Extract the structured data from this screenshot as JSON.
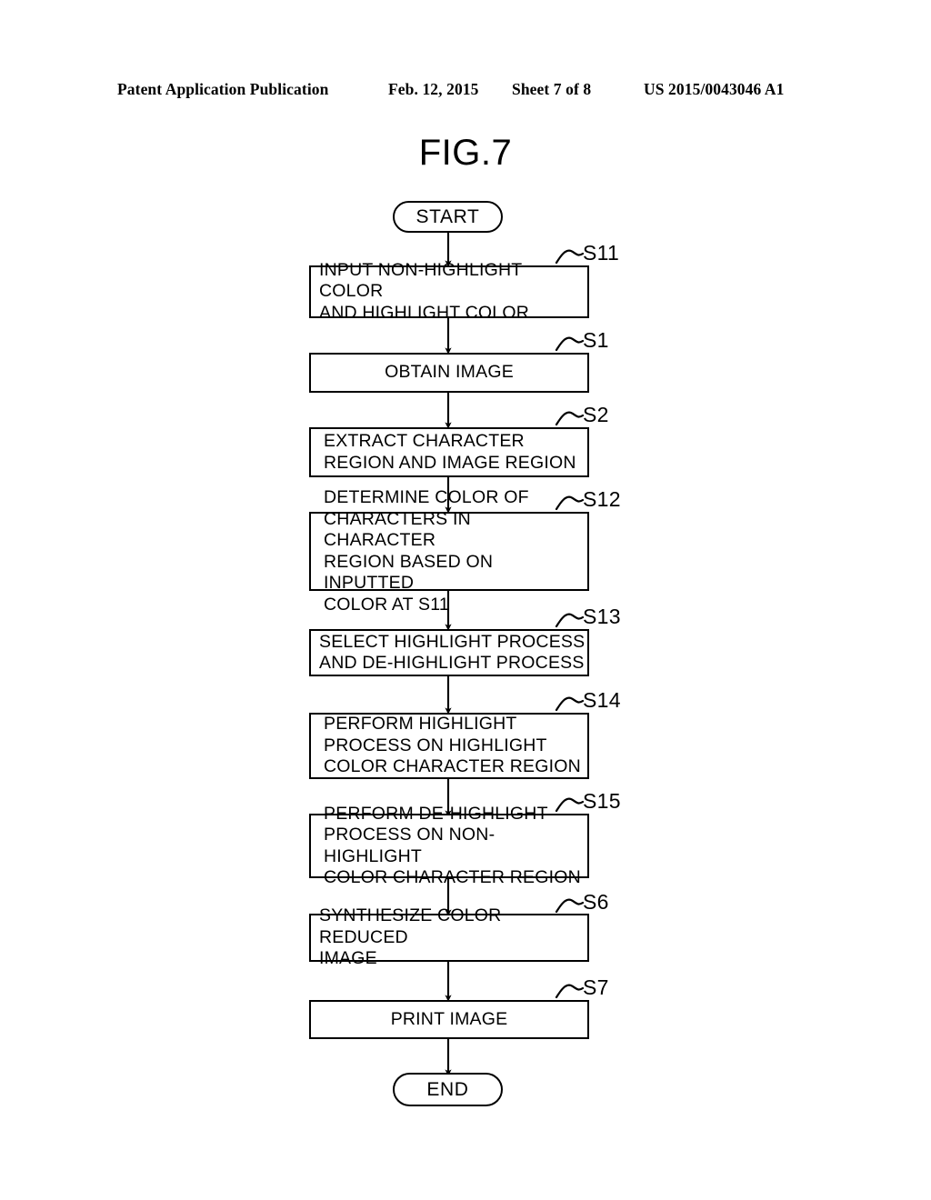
{
  "header": {
    "publication": "Patent Application Publication",
    "date": "Feb. 12, 2015",
    "sheet": "Sheet 7 of 8",
    "number": "US 2015/0043046 A1"
  },
  "figure": {
    "title": "FIG.7"
  },
  "flowchart": {
    "start_label": "START",
    "end_label": "END",
    "steps": [
      {
        "id": "S11",
        "label": "S11",
        "text": "INPUT NON-HIGHLIGHT COLOR\nAND HIGHLIGHT COLOR",
        "lines": 2,
        "align": "left"
      },
      {
        "id": "S1",
        "label": "S1",
        "text": "OBTAIN IMAGE",
        "lines": 1,
        "align": "center"
      },
      {
        "id": "S2",
        "label": "S2",
        "text": "EXTRACT CHARACTER\nREGION AND IMAGE REGION",
        "lines": 2,
        "align": "left2"
      },
      {
        "id": "S12",
        "label": "S12",
        "text": "DETERMINE COLOR OF\nCHARACTERS IN CHARACTER\nREGION BASED ON INPUTTED\nCOLOR AT S11",
        "lines": 4,
        "align": "left2"
      },
      {
        "id": "S13",
        "label": "S13",
        "text": "SELECT HIGHLIGHT PROCESS\nAND DE-HIGHLIGHT PROCESS",
        "lines": 2,
        "align": "left"
      },
      {
        "id": "S14",
        "label": "S14",
        "text": "PERFORM HIGHLIGHT\nPROCESS ON HIGHLIGHT\nCOLOR CHARACTER REGION",
        "lines": 3,
        "align": "left2"
      },
      {
        "id": "S15",
        "label": "S15",
        "text": "PERFORM DE-HIGHLIGHT\nPROCESS ON NON-HIGHLIGHT\nCOLOR CHARACTER REGION",
        "lines": 3,
        "align": "left2"
      },
      {
        "id": "S6",
        "label": "S6",
        "text": "SYNTHESIZE COLOR REDUCED\nIMAGE",
        "lines": 2,
        "align": "left"
      },
      {
        "id": "S7",
        "label": "S7",
        "text": "PRINT IMAGE",
        "lines": 1,
        "align": "center"
      }
    ]
  },
  "colors": {
    "ink": "#000000",
    "paper": "#ffffff"
  }
}
